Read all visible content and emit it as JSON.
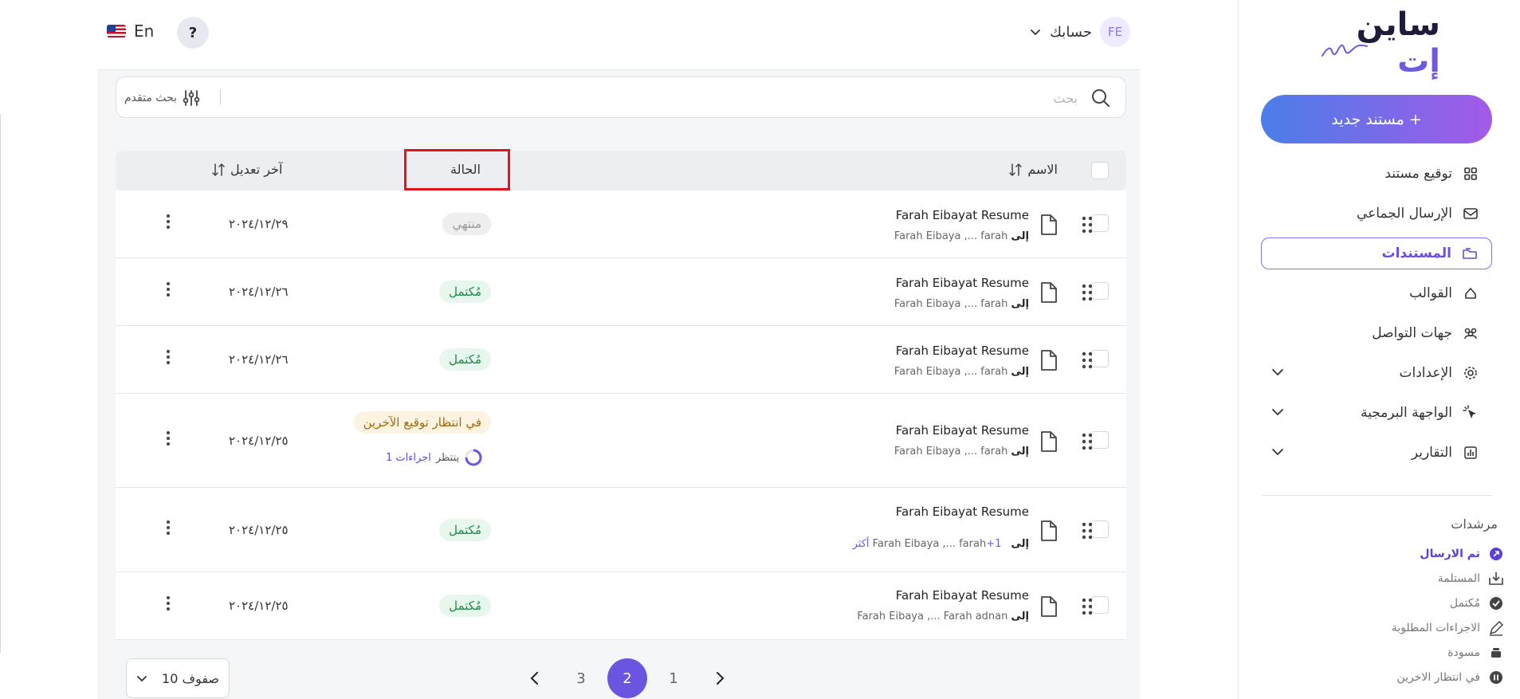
{
  "sidebar": {
    "logo": {
      "text_main": "ساين ",
      "text_accent": "إت"
    },
    "new_document": {
      "label": "+ مستند جديد"
    },
    "nav": [
      {
        "label": "توقيع مستند",
        "icon": "grid-icon"
      },
      {
        "label": "الإرسال الجماعي",
        "icon": "mail-icon"
      },
      {
        "label": "المستندات",
        "icon": "folder-icon",
        "active": true
      },
      {
        "label": "القوالب",
        "icon": "template-icon"
      },
      {
        "label": "جهات التواصل",
        "icon": "contacts-icon"
      },
      {
        "label": "الإعدادات",
        "icon": "gear-icon",
        "expandable": true
      },
      {
        "label": "الواجهة البرمجية",
        "icon": "pointer-icon",
        "expandable": true
      },
      {
        "label": "التقارير",
        "icon": "chart-icon",
        "expandable": true
      }
    ],
    "indicators_title": "مرشدات",
    "indicators": [
      {
        "label": "تم الارسال",
        "icon": "sent-icon",
        "active": true
      },
      {
        "label": "المستلمة",
        "icon": "inbox-icon"
      },
      {
        "label": "مُكتمل",
        "icon": "check-circle-icon"
      },
      {
        "label": "الاجراءات المطلوبة",
        "icon": "pen-icon"
      },
      {
        "label": "مسودة",
        "icon": "draft-icon"
      },
      {
        "label": "في انتظار الاخرين",
        "icon": "pause-icon"
      }
    ]
  },
  "topbar": {
    "language": "En",
    "help": "?",
    "account_label": "حسابك",
    "avatar_initials": "FE"
  },
  "search": {
    "placeholder": "بحث",
    "advanced_label": "بحث متقدم"
  },
  "table": {
    "headers": {
      "name": "الاسم",
      "status": "الحالة",
      "last_modified": "آخر تعديل"
    },
    "rows": [
      {
        "name": "Farah Eibayat Resume",
        "to": "إلى",
        "recipients": "Farah Eibaya ,... farah",
        "status": "منتهي",
        "status_type": "ended",
        "date": "٢٠٢٤/١٢/٢٩"
      },
      {
        "name": "Farah Eibayat Resume",
        "to": "إلى",
        "recipients": "Farah Eibaya ,... farah",
        "status": "مُكتمل",
        "status_type": "done",
        "date": "٢٠٢٤/١٢/٢٦"
      },
      {
        "name": "Farah Eibayat Resume",
        "to": "إلى",
        "recipients": "Farah Eibaya ,... farah",
        "status": "مُكتمل",
        "status_type": "done",
        "date": "٢٠٢٤/١٢/٢٦"
      },
      {
        "name": "Farah Eibayat Resume",
        "to": "إلى",
        "recipients": "Farah Eibaya ,... farah",
        "status": "في انتظار توقيع الآخرين",
        "status_type": "wait",
        "pending_label": "ينتظر",
        "pending_actions": "1 اجراءات",
        "date": "٢٠٢٤/١٢/٢٥"
      },
      {
        "name": "Farah Eibayat Resume",
        "to": "إلى",
        "recipients": "Farah Eibaya ,... farah",
        "more": "+1 أكثر",
        "status": "مُكتمل",
        "status_type": "done",
        "date": "٢٠٢٤/١٢/٢٥"
      },
      {
        "name": "Farah Eibayat Resume",
        "to": "إلى",
        "recipients": "Farah Eibaya ,... Farah adnan",
        "status": "مُكتمل",
        "status_type": "done",
        "date": "٢٠٢٤/١٢/٢٥"
      }
    ]
  },
  "pagination": {
    "rows_per_page": "10 صفوف",
    "pages": [
      "3",
      "2",
      "1"
    ],
    "current": "2"
  },
  "colors": {
    "accent": "#6a55e0",
    "gradient_start": "#4a7ee8",
    "gradient_end": "#a35ae8",
    "highlight": "#e0141b"
  }
}
